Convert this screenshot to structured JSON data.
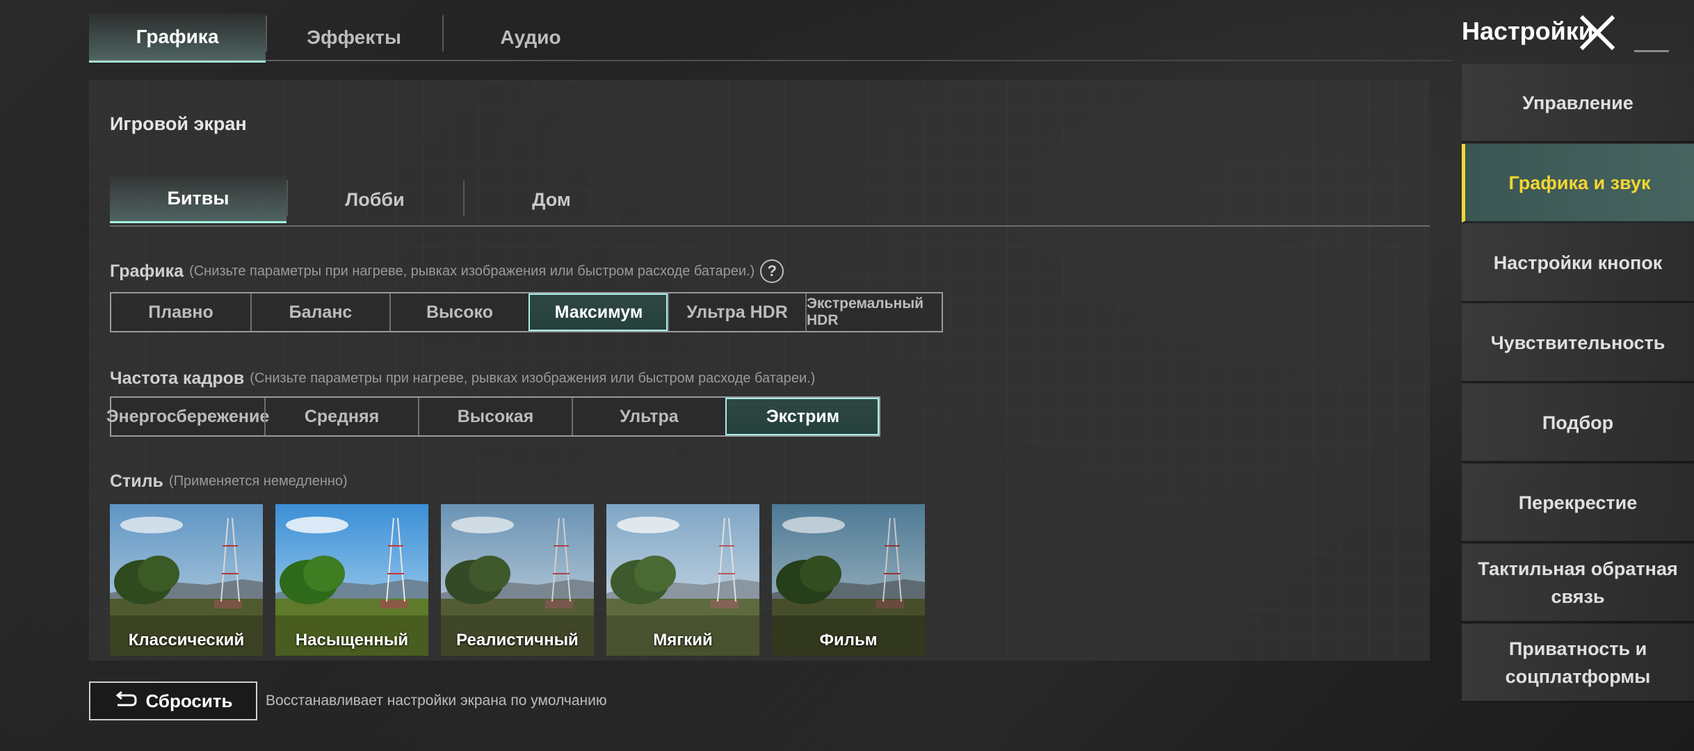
{
  "top_tabs": [
    {
      "label": "Графика",
      "active": true
    },
    {
      "label": "Эффекты",
      "active": false
    },
    {
      "label": "Аудио",
      "active": false
    }
  ],
  "header": {
    "title": "Настройки"
  },
  "panel": {
    "section_title": "Игровой экран",
    "sub_tabs": [
      {
        "label": "Битвы",
        "active": true
      },
      {
        "label": "Лобби",
        "active": false
      },
      {
        "label": "Дом",
        "active": false
      }
    ],
    "graphics": {
      "label": "Графика",
      "hint": "(Снизьте параметры при нагреве, рывках изображения или быстром расходе батареи.)",
      "help_glyph": "?",
      "options": [
        "Плавно",
        "Баланс",
        "Высоко",
        "Максимум",
        "Ультра HDR",
        "Экстремальный HDR"
      ],
      "selected": "Максимум"
    },
    "fps": {
      "label": "Частота кадров",
      "hint": "(Снизьте параметры при нагреве, рывках изображения или быстром расходе батареи.)",
      "options": [
        "Энергосбережение",
        "Средняя",
        "Высокая",
        "Ультра",
        "Экстрим"
      ],
      "selected": "Экстрим"
    },
    "style": {
      "label": "Стиль",
      "hint": "(Применяется немедленно)",
      "options": [
        "Классический",
        "Насыщенный",
        "Реалистичный",
        "Мягкий",
        "Фильм"
      ],
      "selected": "Классический"
    }
  },
  "reset": {
    "label": "Сбросить",
    "note": "Восстанавливает настройки экрана по умолчанию"
  },
  "sidebar": {
    "items": [
      {
        "label": "Управление",
        "active": false
      },
      {
        "label": "Графика и звук",
        "active": true
      },
      {
        "label": "Настройки кнопок",
        "active": false
      },
      {
        "label": "Чувствительность",
        "active": false
      },
      {
        "label": "Подбор",
        "active": false
      },
      {
        "label": "Перекрестие",
        "active": false
      },
      {
        "label": "Тактильная обратная связь",
        "active": false
      },
      {
        "label": "Приватность и соцплатформы",
        "active": false
      }
    ]
  },
  "colors": {
    "accent_teal": "#a8f0e4",
    "accent_yellow": "#f4d632",
    "selection_yellow": "#f2d22e"
  }
}
